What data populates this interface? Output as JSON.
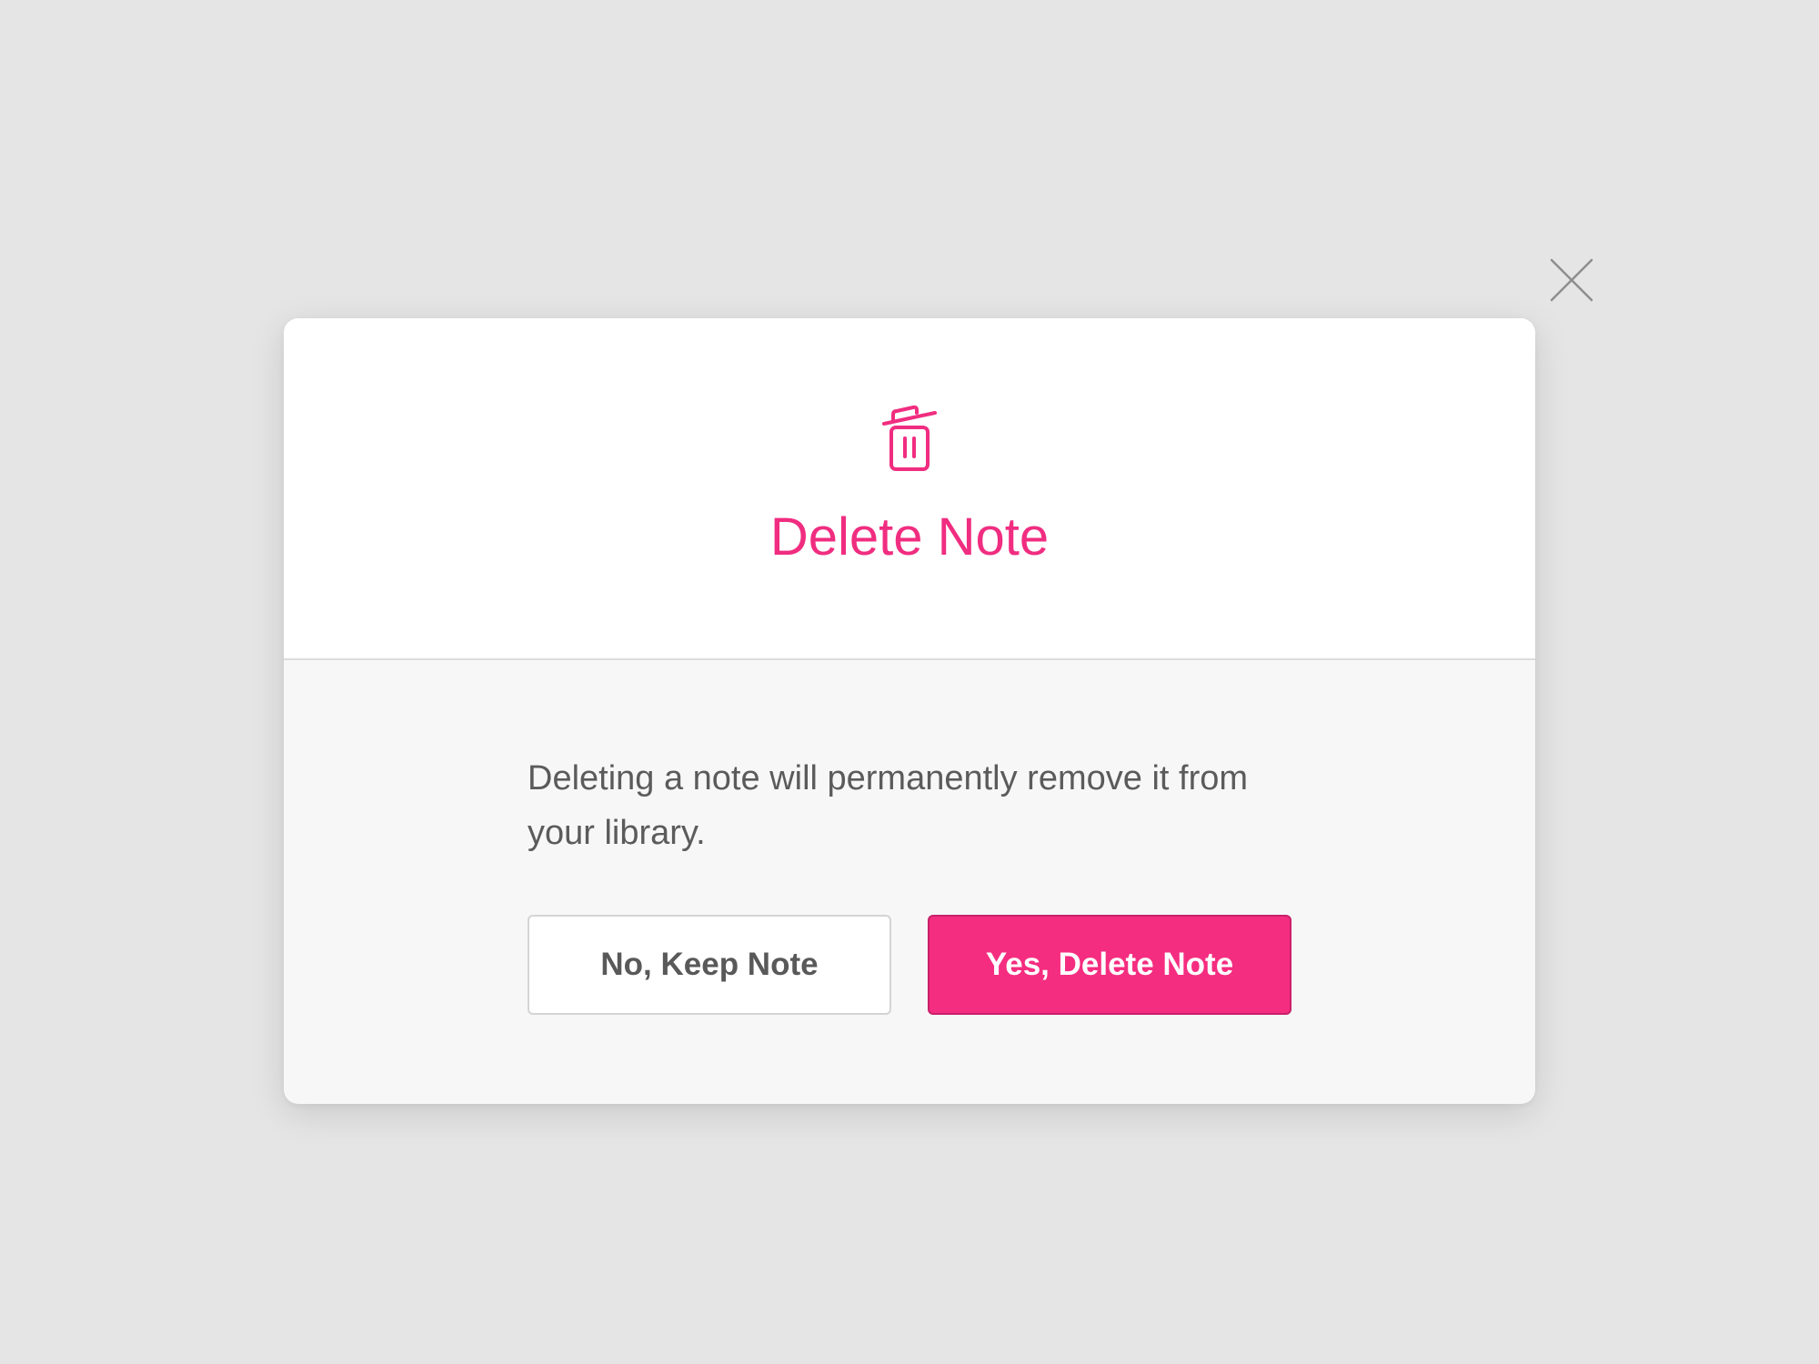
{
  "overlay": {
    "close_icon": "close-icon",
    "close_color": "#8e8e8e"
  },
  "dialog": {
    "icon": "trash-icon",
    "accent_color": "#f02d80",
    "title": "Delete Note",
    "message": "Deleting a note will permanently remove it from your library.",
    "buttons": {
      "keep_label": "No, Keep Note",
      "delete_label": "Yes, Delete Note"
    }
  }
}
